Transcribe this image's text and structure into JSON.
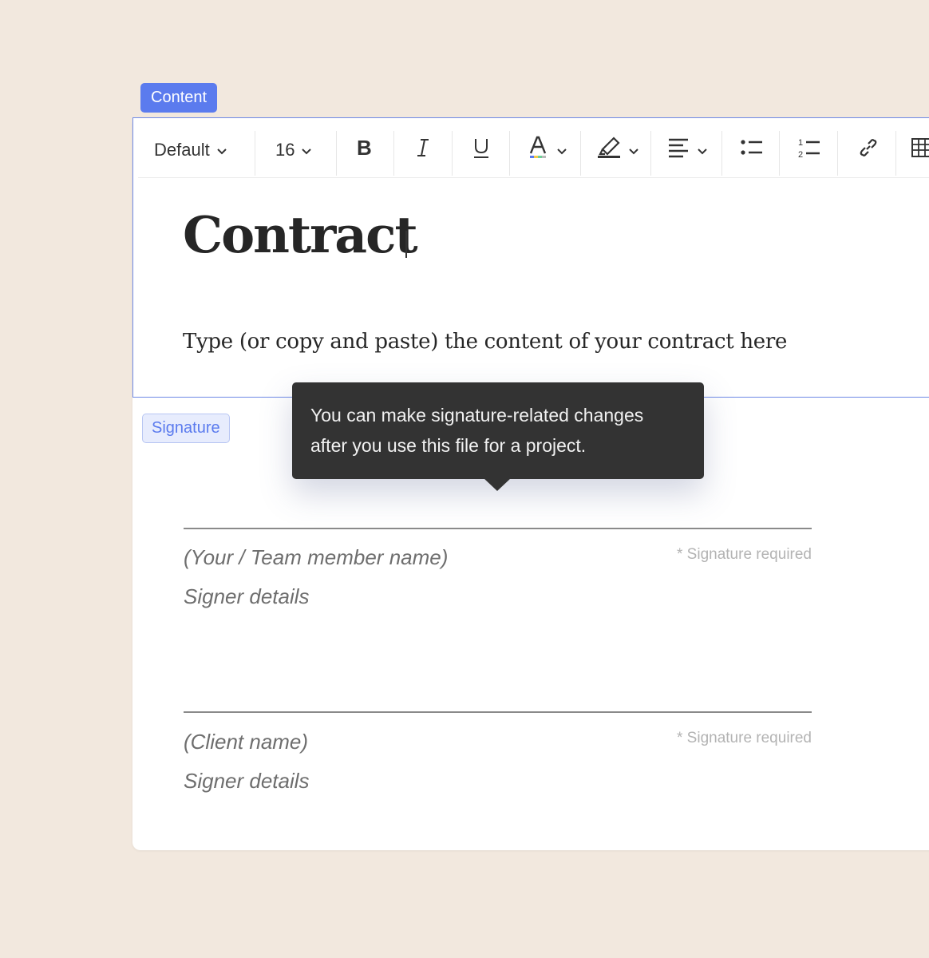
{
  "content_tag": "Content",
  "toolbar": {
    "style_select": "Default",
    "font_size_select": "16",
    "items": [
      "bold-icon",
      "italic-icon",
      "underline-icon",
      "text-color-icon",
      "highlight-icon",
      "align-icon",
      "bullet-list-icon",
      "numbered-list-icon",
      "link-icon",
      "table-icon"
    ],
    "accent": "#5b7bee"
  },
  "document": {
    "title": "Contract",
    "body": "Type (or copy and paste) the content of your contract here"
  },
  "signature_tag": "Signature",
  "tooltip": {
    "line1": "You can make signature-related changes",
    "line2": "after you use this file for a project."
  },
  "signers": [
    {
      "name": "(Your / Team member name)",
      "details": "Signer details",
      "required": "* Signature required"
    },
    {
      "name": "(Client name)",
      "details": "Signer details",
      "required": "* Signature required"
    }
  ],
  "colors": {
    "background": "#f2e8de",
    "tooltip": "#333333",
    "selection_border": "#6f8ae6"
  }
}
